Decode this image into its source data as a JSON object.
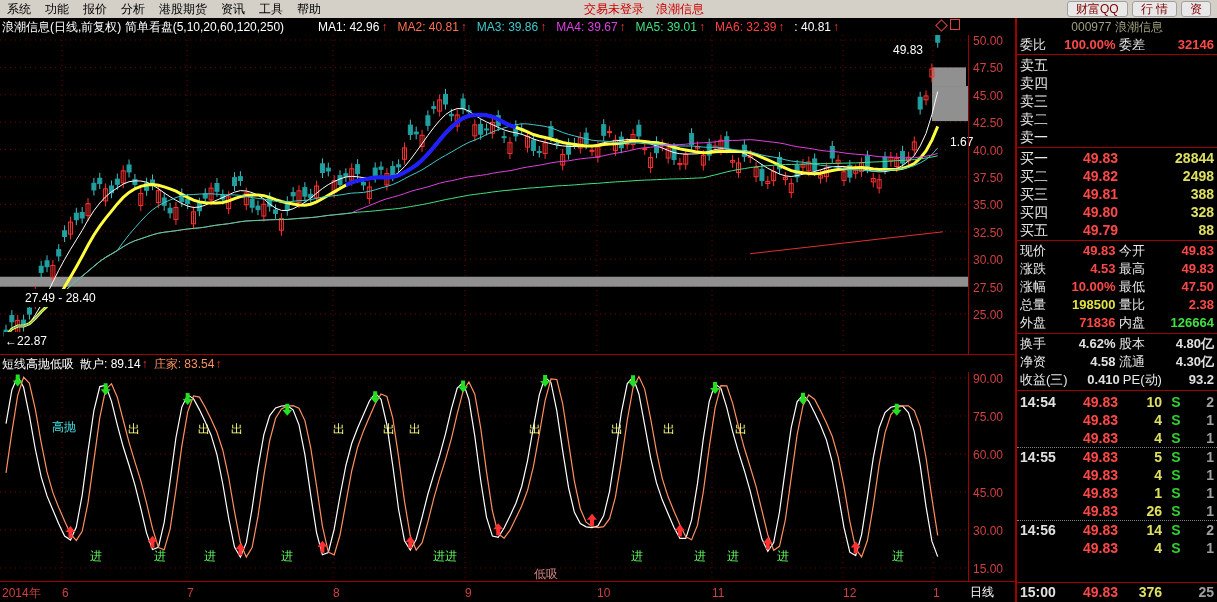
{
  "menu": [
    "系统",
    "功能",
    "报价",
    "分析",
    "港股期货",
    "资讯",
    "工具",
    "帮助"
  ],
  "status_links": [
    "交易未登录",
    "浪潮信息"
  ],
  "top_buttons": [
    "财富QQ",
    "行 情",
    "资"
  ],
  "chart_title": "浪潮信息(日线,前复权) 简单看盘(5,10,20,60,120,250)",
  "ma_values": [
    {
      "label": "MA1: 42.96",
      "color": "#ffffff"
    },
    {
      "label": "MA2: 40.81",
      "color": "#ff7050"
    },
    {
      "label": "MA3: 39.86",
      "color": "#40c8c8"
    },
    {
      "label": "MA4: 39.67",
      "color": "#e040e0"
    },
    {
      "label": "MA5: 39.01",
      "color": "#40e080"
    },
    {
      "label": "MA6: 32.39",
      "color": "#ff4040"
    },
    {
      "label": ": 40.81",
      "color": "#ffffff"
    }
  ],
  "trend_mark": "↑",
  "main_axis": [
    "50.00",
    "47.50",
    "45.00",
    "42.50",
    "40.00",
    "37.50",
    "35.00",
    "32.50",
    "30.00",
    "27.50",
    "25.00"
  ],
  "main_annotations": {
    "range": "27.49 - 28.40",
    "low": "←22.87",
    "high": "49.83",
    "last": "1.67"
  },
  "indicator": {
    "title": "短线高抛低吸",
    "series": [
      {
        "label": "散户: 89.14",
        "color": "#ffffff"
      },
      {
        "label": "庄家: 83.54",
        "color": "#ff9060"
      }
    ],
    "axis": [
      "90.00",
      "75.00",
      "60.00",
      "45.00",
      "30.00",
      "15.00"
    ],
    "high_label": "高抛",
    "low_label": "低吸",
    "sell_labels": [
      "出",
      "出",
      "出",
      "出",
      "出",
      "出",
      "出",
      "出",
      "出",
      "出"
    ],
    "buy_labels": [
      "进",
      "进",
      "进",
      "进",
      "进进",
      "进",
      "进",
      "进",
      "进",
      "进"
    ]
  },
  "time_axis": [
    "2014年",
    "6",
    "7",
    "8",
    "9",
    "10",
    "11",
    "12",
    "1"
  ],
  "period": "日线",
  "quote_panel": {
    "header": "000977 浪潮信息",
    "ratio": {
      "label": "委比",
      "value": "100.00%",
      "label2": "委差",
      "value2": "32146"
    },
    "sell": [
      "卖五",
      "卖四",
      "卖三",
      "卖二",
      "卖一"
    ],
    "buy": [
      {
        "label": "买一",
        "price": "49.83",
        "volume": "28844"
      },
      {
        "label": "买二",
        "price": "49.82",
        "volume": "2498"
      },
      {
        "label": "买三",
        "price": "49.81",
        "volume": "388"
      },
      {
        "label": "买四",
        "price": "49.80",
        "volume": "328"
      },
      {
        "label": "买五",
        "price": "49.79",
        "volume": "88"
      }
    ],
    "quotes": [
      {
        "label": "现价",
        "value": "49.83",
        "color": "#ff4848"
      },
      {
        "label": "今开",
        "value": "49.83",
        "color": "#ff4848"
      },
      {
        "label": "涨跌",
        "value": "4.53",
        "color": "#ff4848"
      },
      {
        "label": "最高",
        "value": "49.83",
        "color": "#ff4848"
      },
      {
        "label": "涨幅",
        "value": "10.00%",
        "color": "#ff4848"
      },
      {
        "label": "最低",
        "value": "47.50",
        "color": "#ff4848"
      },
      {
        "label": "总量",
        "value": "198500",
        "color": "#e0e040"
      },
      {
        "label": "量比",
        "value": "2.38",
        "color": "#ff4848"
      },
      {
        "label": "外盘",
        "value": "71836",
        "color": "#ff4848"
      },
      {
        "label": "内盘",
        "value": "126664",
        "color": "#40e040"
      }
    ],
    "fundamentals": [
      {
        "label": "换手",
        "value": "4.62%",
        "label2": "股本",
        "value2": "4.80亿"
      },
      {
        "label": "净资",
        "value": "4.58",
        "label2": "流通",
        "value2": "4.30亿"
      },
      {
        "label": "收益(三)",
        "value": "0.410",
        "label2": "PE(动)",
        "value2": "93.2"
      }
    ],
    "ticks": [
      {
        "time": "14:54",
        "trades": [
          {
            "price": "49.83",
            "volume": "10",
            "side": "S",
            "count": "2"
          },
          {
            "price": "49.83",
            "volume": "4",
            "side": "S",
            "count": "1"
          },
          {
            "price": "49.83",
            "volume": "4",
            "side": "S",
            "count": "1"
          }
        ]
      },
      {
        "time": "14:55",
        "trades": [
          {
            "price": "49.83",
            "volume": "5",
            "side": "S",
            "count": "1"
          },
          {
            "price": "49.83",
            "volume": "4",
            "side": "S",
            "count": "1"
          },
          {
            "price": "49.83",
            "volume": "1",
            "side": "S",
            "count": "1"
          },
          {
            "price": "49.83",
            "volume": "26",
            "side": "S",
            "count": "1"
          }
        ]
      },
      {
        "time": "14:56",
        "trades": [
          {
            "price": "49.83",
            "volume": "14",
            "side": "S",
            "count": "2"
          },
          {
            "price": "49.83",
            "volume": "4",
            "side": "S",
            "count": "1"
          }
        ]
      }
    ],
    "close": {
      "time": "15:00",
      "price": "49.83",
      "volume": "376",
      "count": "25"
    }
  }
}
